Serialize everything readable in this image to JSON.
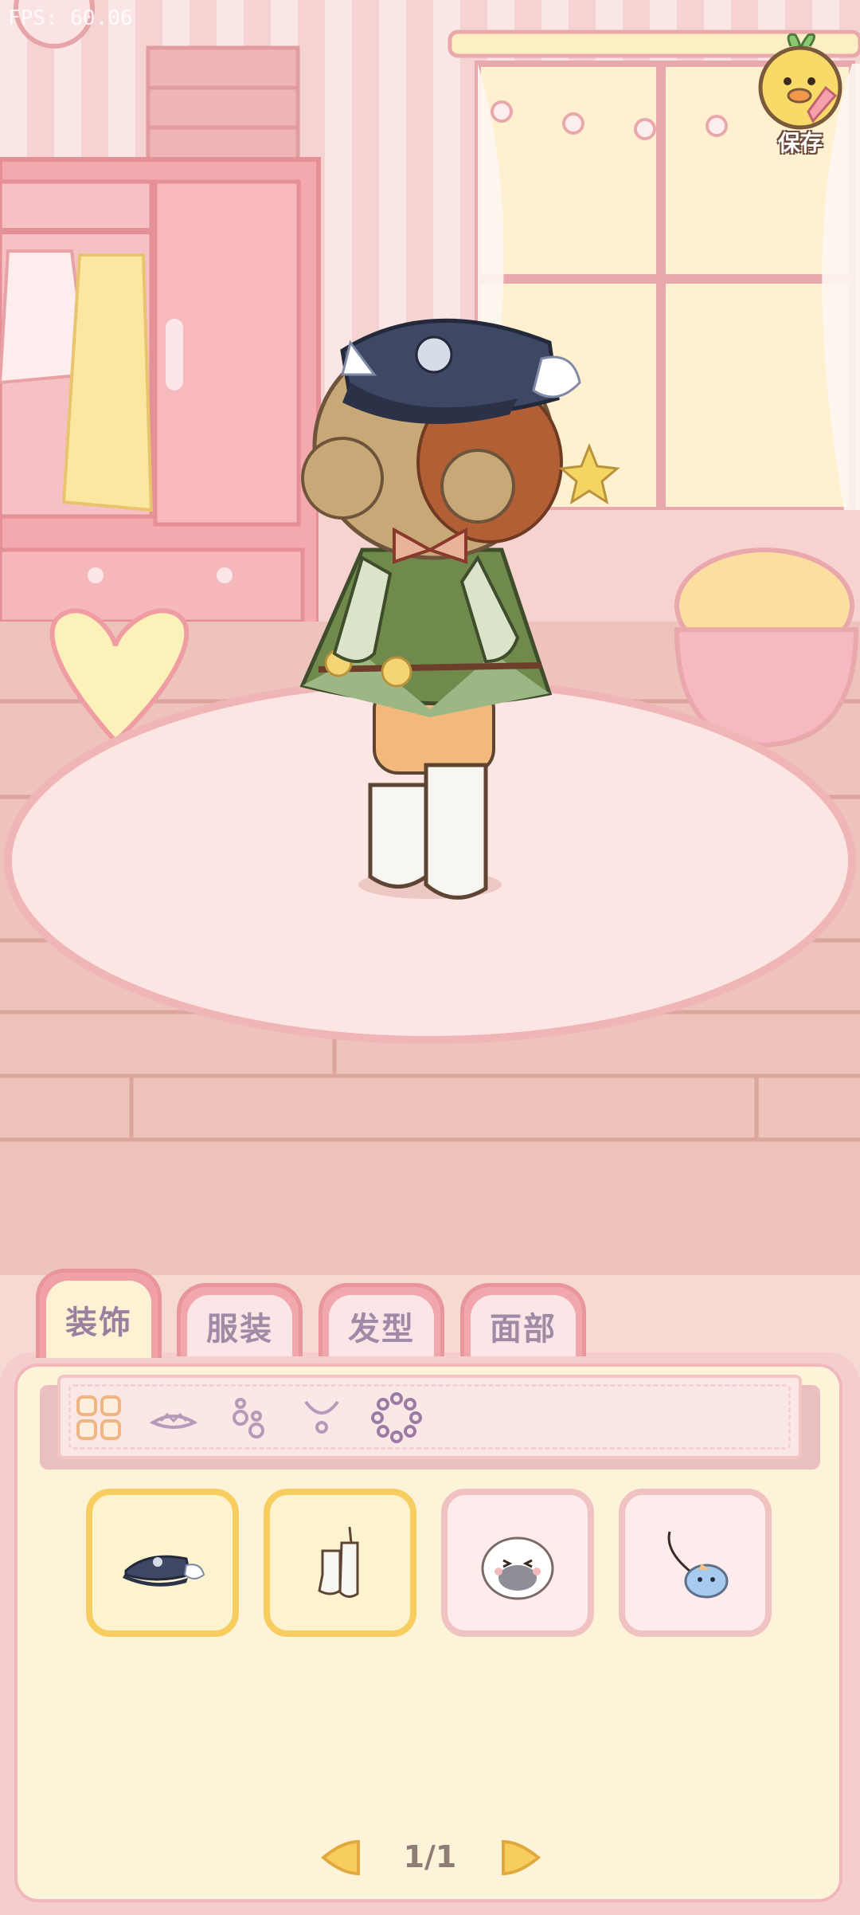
{
  "debug": {
    "fps_text": "FPS: 60.06"
  },
  "header": {
    "save_label": "保存",
    "save_icon": "duck-save-icon"
  },
  "tabs": [
    {
      "label": "装饰",
      "active": true
    },
    {
      "label": "服装",
      "active": false
    },
    {
      "label": "发型",
      "active": false
    },
    {
      "label": "面部",
      "active": false
    }
  ],
  "subcategories": [
    {
      "icon": "grid-all-icon",
      "selected": false
    },
    {
      "icon": "crown-icon",
      "selected": false
    },
    {
      "icon": "earrings-icon",
      "selected": false
    },
    {
      "icon": "necklace-icon",
      "selected": false
    },
    {
      "icon": "ring-wreath-icon",
      "selected": false
    }
  ],
  "items": [
    {
      "icon": "navy-cap-with-wings-icon",
      "equipped": true
    },
    {
      "icon": "white-socks-icon",
      "equipped": true
    },
    {
      "icon": "duck-pillow-icon",
      "equipped": false
    },
    {
      "icon": "bird-charm-icon",
      "equipped": false
    }
  ],
  "pagination": {
    "page_text": "1/1"
  },
  "colors": {
    "panel_bg": "#fdf3d8",
    "tab_pink": "#f2a7ad",
    "tab_text": "#a08aa6",
    "equipped_border": "#f7cd5f"
  }
}
